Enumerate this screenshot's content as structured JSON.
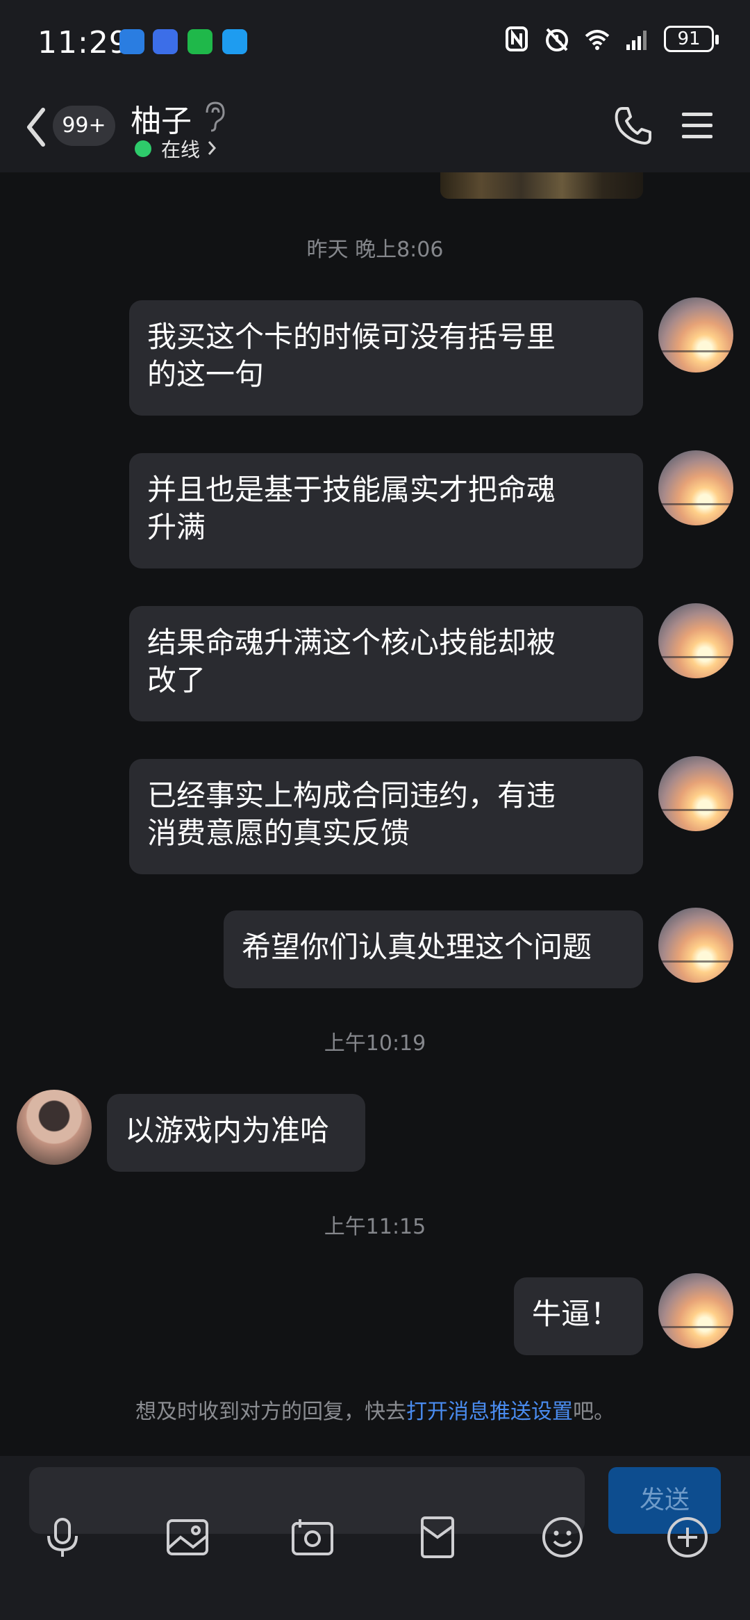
{
  "status_bar": {
    "time": "11:29",
    "battery": "91"
  },
  "header": {
    "unread_badge": "99+",
    "contact_name": "柚子",
    "status_text": "在线"
  },
  "chat": {
    "timestamps": [
      "昨天 晚上8:06",
      "上午10:19",
      "上午11:15"
    ],
    "messages": [
      {
        "from": "me",
        "text_lines": [
          "我买这个卡的时候可没有括号里",
          "的这一句"
        ]
      },
      {
        "from": "me",
        "text_lines": [
          "并且也是基于技能属实才把命魂",
          "升满"
        ]
      },
      {
        "from": "me",
        "text_lines": [
          "结果命魂升满这个核心技能却被",
          "改了"
        ]
      },
      {
        "from": "me",
        "text_lines": [
          "已经事实上构成合同违约，有违",
          "消费意愿的真实反馈"
        ]
      },
      {
        "from": "me",
        "text_lines": [
          "希望你们认真处理这个问题"
        ]
      },
      {
        "from": "peer",
        "text_lines": [
          "以游戏内为准哈"
        ]
      },
      {
        "from": "me",
        "text_lines": [
          "牛逼！"
        ]
      }
    ],
    "notice": {
      "prefix": "想及时收到对方的回复，快去",
      "link": "打开消息推送设置",
      "suffix": "吧。"
    }
  },
  "input": {
    "value": "",
    "send_label": "发送"
  },
  "toolbar_icons": [
    "mic-icon",
    "image-icon",
    "camera-icon",
    "red-packet-icon",
    "emoji-icon",
    "plus-icon"
  ],
  "colors": {
    "background": "#111214",
    "bubble": "#2a2b30",
    "online": "#2ecb6b",
    "link": "#4a8cf0",
    "send": "#0d4d8f"
  }
}
